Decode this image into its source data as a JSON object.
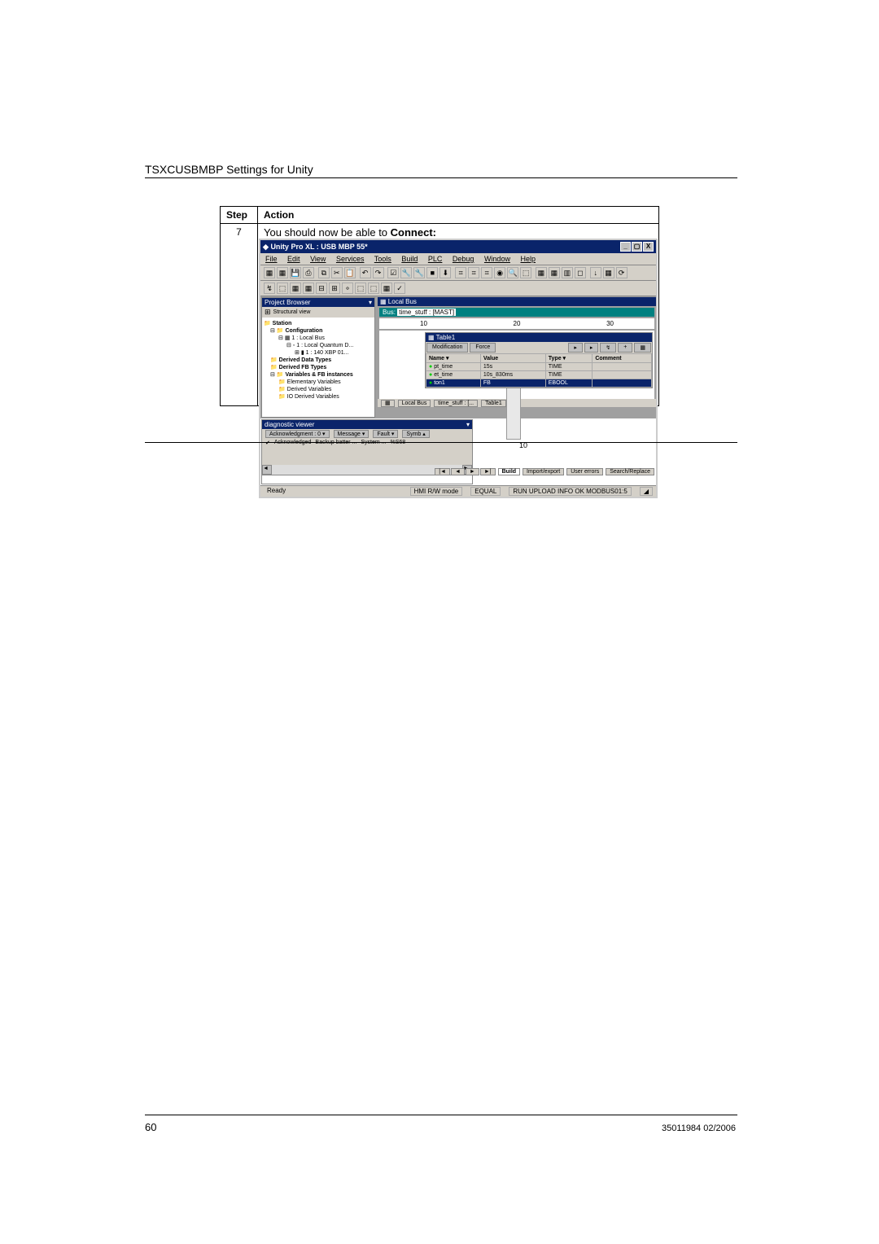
{
  "header": "TSXCUSBMBP Settings for Unity",
  "table": {
    "col_step": "Step",
    "col_action": "Action",
    "step_num": "7",
    "action_prefix": "You should now be able to ",
    "action_bold": "Connect:"
  },
  "app": {
    "title": "Unity Pro XL : USB MBP 55*",
    "win_buttons": [
      "_",
      "▢",
      "X"
    ],
    "menu": [
      "File",
      "Edit",
      "View",
      "Services",
      "Tools",
      "Build",
      "PLC",
      "Debug",
      "Window",
      "Help"
    ]
  },
  "project_browser": {
    "title": "Project Browser",
    "view_label": "Structural view",
    "nodes": [
      "Station",
      "Configuration",
      "1 : Local Bus",
      "1 : Local Quantum D...",
      "1 : 140 XBP 01...",
      "Derived Data Types",
      "Derived FB Types",
      "Variables & FB instances",
      "Elementary Variables",
      "Derived Variables",
      "IO Derived Variables"
    ]
  },
  "localbus": {
    "title": "Local Bus",
    "bus_label": "Bus:",
    "bus_name": "time_stuff : [MAST]",
    "ruler": [
      "10",
      "20",
      "30"
    ],
    "plc_slot": "10"
  },
  "table1": {
    "title": "Table1",
    "btn_mod": "Modification",
    "btn_force": "Force",
    "cols": [
      "Name",
      "Value",
      "Type",
      "Comment"
    ],
    "rows": [
      {
        "name": "pt_time",
        "value": "15s",
        "type": "TIME",
        "hl": false
      },
      {
        "name": "et_time",
        "value": "10s_830ms",
        "type": "TIME",
        "hl": false
      },
      {
        "name": "ton1",
        "value": "FB",
        "type": "EBOOL",
        "hl": true
      }
    ]
  },
  "mdi_tabs": [
    "Local Bus",
    "time_stuff : [...",
    "Table1"
  ],
  "diagnostic": {
    "title": "diagnostic viewer",
    "tabs": [
      "Acknowledgment : 0",
      "Message",
      "Fault",
      "Symb"
    ],
    "row": [
      "Acknowledged",
      "Backup batter ...",
      "System ...",
      "%S68"
    ]
  },
  "output_tabs": {
    "nav": [
      "|◄",
      "◄",
      "►",
      "►|"
    ],
    "tabs": [
      "Build",
      "Import/export",
      "User errors",
      "Search/Replace"
    ]
  },
  "status": {
    "ready": "Ready",
    "hmi": "HMI R/W mode",
    "equal": "EQUAL",
    "run_info": "RUN  UPLOAD INFO OK  MODBUS01:5"
  },
  "footer": {
    "page": "60",
    "docref": "35011984 02/2006"
  }
}
